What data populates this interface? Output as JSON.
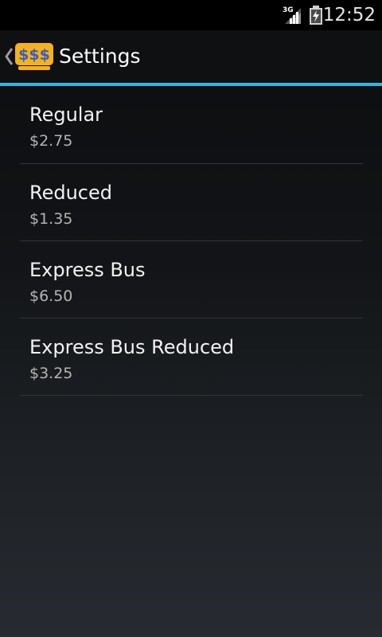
{
  "status_bar": {
    "network_type": "3G",
    "time": "12:52",
    "signal_icon": "signal-icon",
    "battery_icon": "battery-charging-icon"
  },
  "action_bar": {
    "title": "Settings",
    "app_icon_text": "$$$",
    "app_icon_color": "#f5b21a",
    "app_icon_text_color": "#3a5cc9",
    "up_icon": "chevron-left-icon",
    "divider_color": "#33b5e5"
  },
  "fares": [
    {
      "name": "Regular",
      "price": "$2.75"
    },
    {
      "name": "Reduced",
      "price": "$1.35"
    },
    {
      "name": "Express Bus",
      "price": "$6.50"
    },
    {
      "name": "Express Bus Reduced",
      "price": "$3.25"
    }
  ]
}
